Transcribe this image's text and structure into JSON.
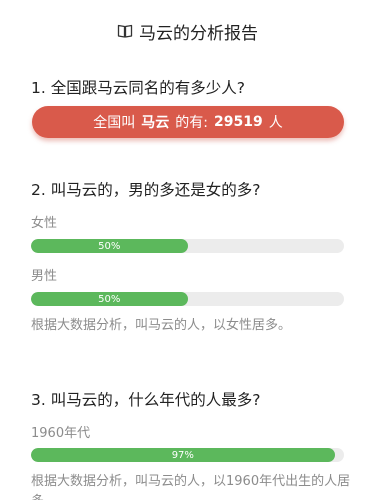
{
  "header": {
    "title": "马云的分析报告",
    "icon": "book-icon"
  },
  "q1": {
    "title": "1. 全国跟马云同名的有多少人?",
    "banner_prefix": "全国叫",
    "banner_name": "马云",
    "banner_middle": "的有:",
    "banner_count": "29519",
    "banner_unit": "人",
    "banner_color": "#d95a4b"
  },
  "q2": {
    "title": "2. 叫马云的，男的多还是女的多?",
    "bars": [
      {
        "label": "女性",
        "percent_text": "50%",
        "percent": 50
      },
      {
        "label": "男性",
        "percent_text": "50%",
        "percent": 50
      }
    ],
    "note": "根据大数据分析，叫马云的人，以女性居多。"
  },
  "q3": {
    "title": "3. 叫马云的，什么年代的人最多?",
    "bars": [
      {
        "label": "1960年代",
        "percent_text": "97%",
        "percent": 97
      }
    ],
    "note": "根据大数据分析，叫马云的人，以1960年代出生的人居多。"
  },
  "colors": {
    "bar_fill": "#5cb85c",
    "bar_track": "#ececec"
  }
}
